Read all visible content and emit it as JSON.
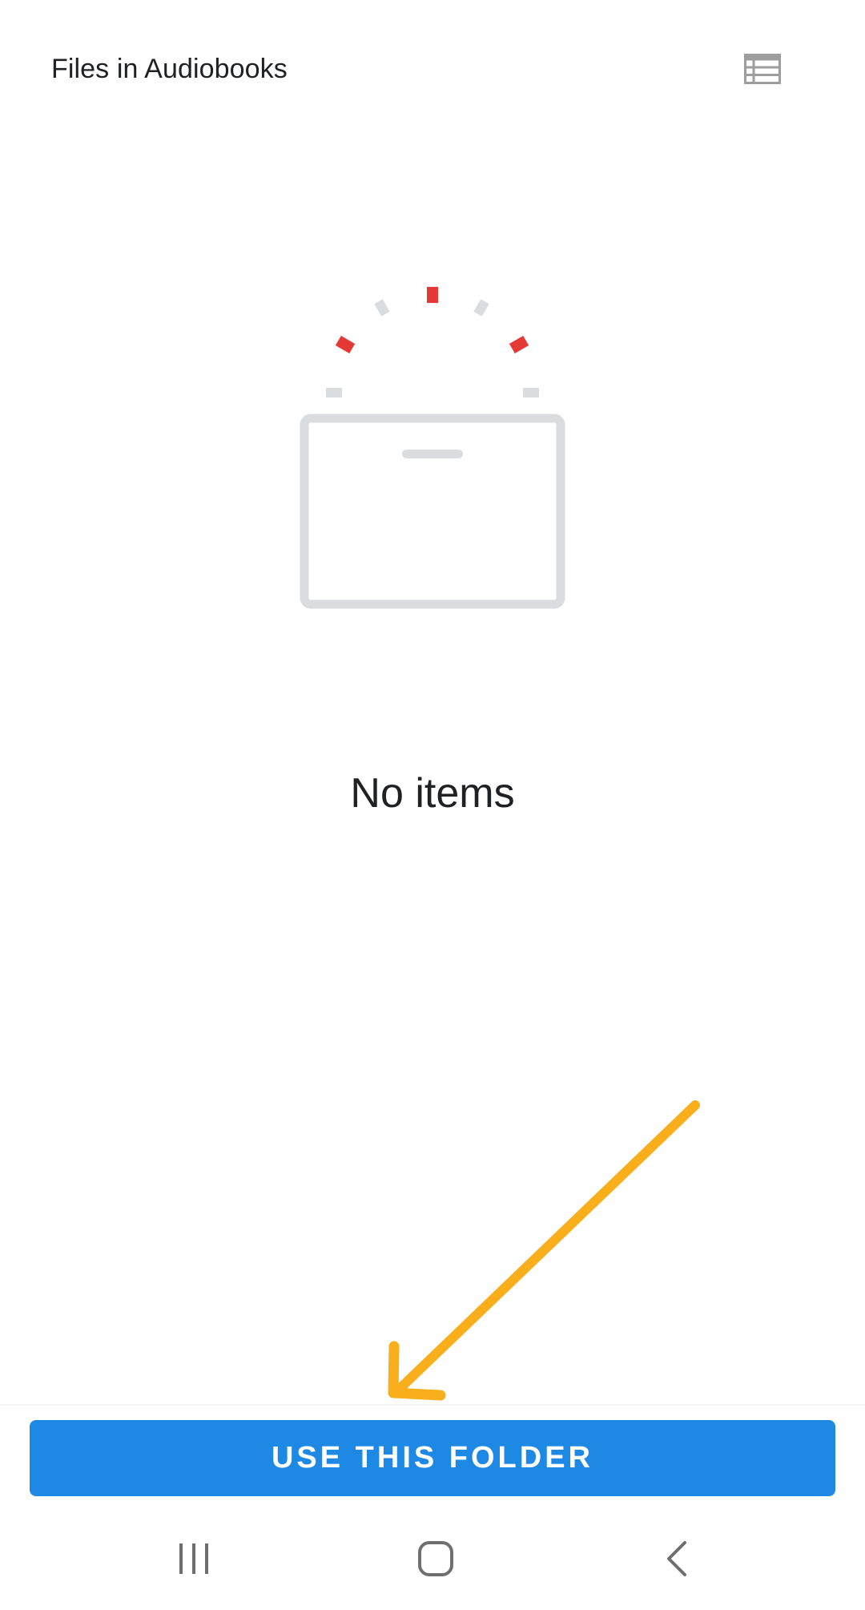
{
  "header": {
    "title": "Files in Audiobooks",
    "view_toggle_icon": "list-view-icon"
  },
  "empty_state": {
    "message": "No items",
    "illustration": "empty-folder-illustration"
  },
  "annotation": {
    "arrow_color": "#f9ae1b",
    "arrow_icon": "arrow-annotation"
  },
  "actions": {
    "primary_label": "USE THIS FOLDER",
    "primary_color": "#1e88e5"
  },
  "nav_bar": {
    "recents_icon": "recents-icon",
    "home_icon": "home-icon",
    "back_icon": "back-icon"
  },
  "colors": {
    "background": "#ffffff",
    "text": "#202124",
    "icon_gray": "#9e9e9e",
    "illustration_gray": "#dadce0",
    "illustration_red": "#e53935"
  }
}
